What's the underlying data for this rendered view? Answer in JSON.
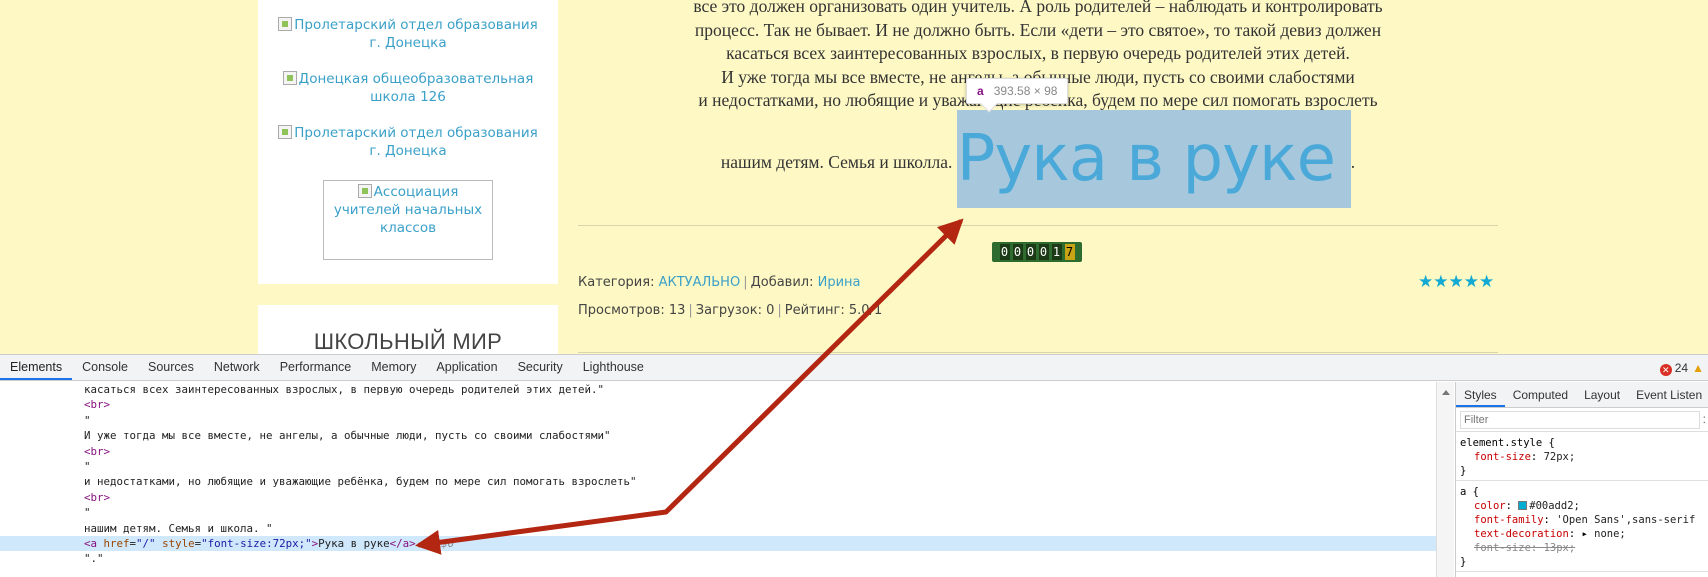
{
  "sidebar": {
    "links": [
      "Пролетарский отдел образования г. Донецка",
      "Донецкая общеобразовательная школа 126",
      "Пролетарский отдел образования г. Донецка",
      "Ассоциация учителей начальных классов"
    ],
    "widget_title": "ШКОЛЬНЫЙ МИР"
  },
  "article": {
    "lines": [
      "все это должен организовать один учитель. А роль родителей – наблюдать и контролировать",
      "процесс. Так не бывает. И не должно быть. Если «дети – это святое», то такой девиз должен",
      "касаться всех заинтересованных взрослых, в первую очередь родителей этих детей.",
      "И уже тогда мы все вместе, не ангелы, а обычные люди, пусть со своими слабостями",
      "и недостатками, но любящие и уважающие ребенка, будем по мере сил помогать взрослеть"
    ],
    "last_line_prefix": "нашим детям. Семья и школла.",
    "big_link": "Рука в руке",
    "last_line_suffix": ".",
    "hover_tip": {
      "tag": "a",
      "size": "393.58 × 98"
    },
    "counter_digits": [
      "0",
      "0",
      "0",
      "0",
      "1",
      "7"
    ],
    "meta1": {
      "category_label": "Категория:",
      "category": "АКТУАЛЬНО",
      "added_label": "Добавил:",
      "author": "Ирина"
    },
    "meta2": {
      "views": "Просмотров: 13",
      "downloads": "Загрузок: 0",
      "rating": "Рейтинг: 5.0/1"
    },
    "stars": "★★★★★"
  },
  "devtools": {
    "tabs": [
      "Elements",
      "Console",
      "Sources",
      "Network",
      "Performance",
      "Memory",
      "Application",
      "Security",
      "Lighthouse"
    ],
    "error_count": "24",
    "code": [
      "касаться всех заинтересованных взрослых, в первую очередь родителей этих детей.\"",
      "<br>",
      "\"",
      "И уже тогда мы все вместе, не ангелы, а обычные люди, пусть со своими слабостями\"",
      "<br>",
      "\"",
      "и недостатками, но любящие и уважающие ребёнка, будем по мере сил помогать взрослеть\"",
      "<br>",
      "\"",
      "нашим детям. Семья и школа. \""
    ],
    "selected": {
      "open": "<a ",
      "attr1": "href",
      "val1": "\"/\"",
      "attr2": "style",
      "val2": "\"font-size:72px;\"",
      "text": "Рука в руке",
      "close": "</a>",
      "marker": "== $0"
    },
    "trailing": "\".\"",
    "styles_tabs": [
      "Styles",
      "Computed",
      "Layout",
      "Event Listen"
    ],
    "filter_placeholder": "Filter",
    "rules": {
      "element_style": "element.style {",
      "font_size_name": "font-size",
      "font_size_val": "72px;",
      "a_selector": "a {",
      "color_name": "color",
      "color_val": "#00add2;",
      "family_name": "font-family",
      "family_val": "'Open Sans',sans-serif",
      "deco_name": "text-decoration",
      "deco_val": "none;",
      "fs13_name": "font-size",
      "fs13_val": "13px;",
      "close": "}"
    }
  },
  "colors": {
    "page_bg": "#fdf8c4",
    "link": "#3aa0c8",
    "arrow": "#b32612",
    "selection": "#cfe8fc"
  }
}
